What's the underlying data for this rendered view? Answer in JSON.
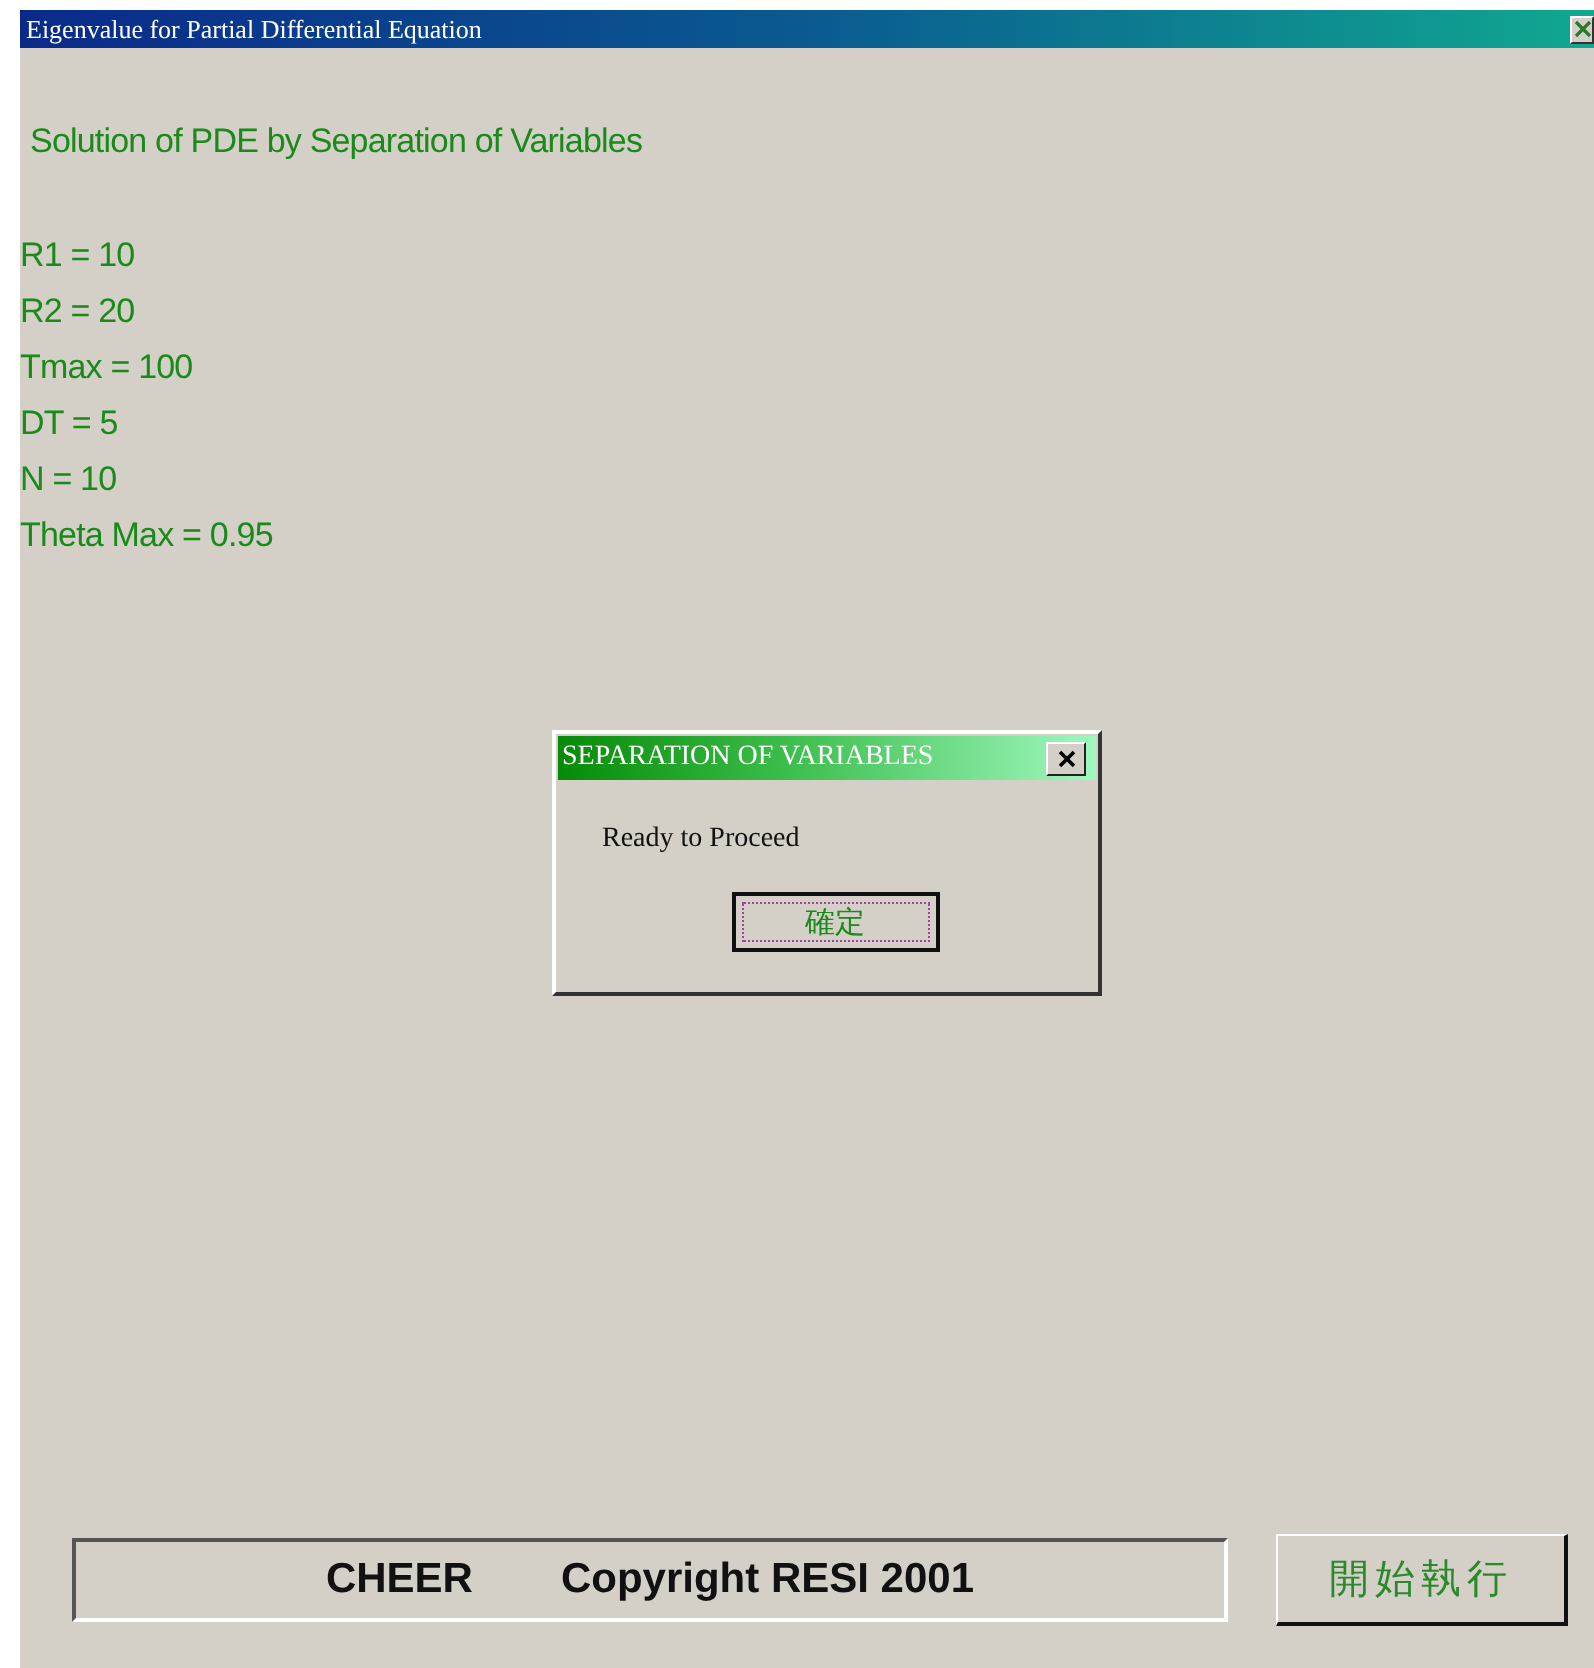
{
  "window": {
    "title": "Eigenvalue for Partial Differential Equation"
  },
  "heading": "Solution of PDE by Separation of Variables",
  "parameters": [
    "R1 =  10",
    "R2 =  20",
    "Tmax =  100",
    "DT =  5",
    "N =  10",
    "Theta Max =  0.95"
  ],
  "dialog": {
    "title": "SEPARATION OF VARIABLES",
    "message": "Ready to Proceed",
    "button": "確定"
  },
  "footer": {
    "texts": [
      "CHEER",
      "Copyright RESI 2001"
    ],
    "button": "開始執行"
  }
}
